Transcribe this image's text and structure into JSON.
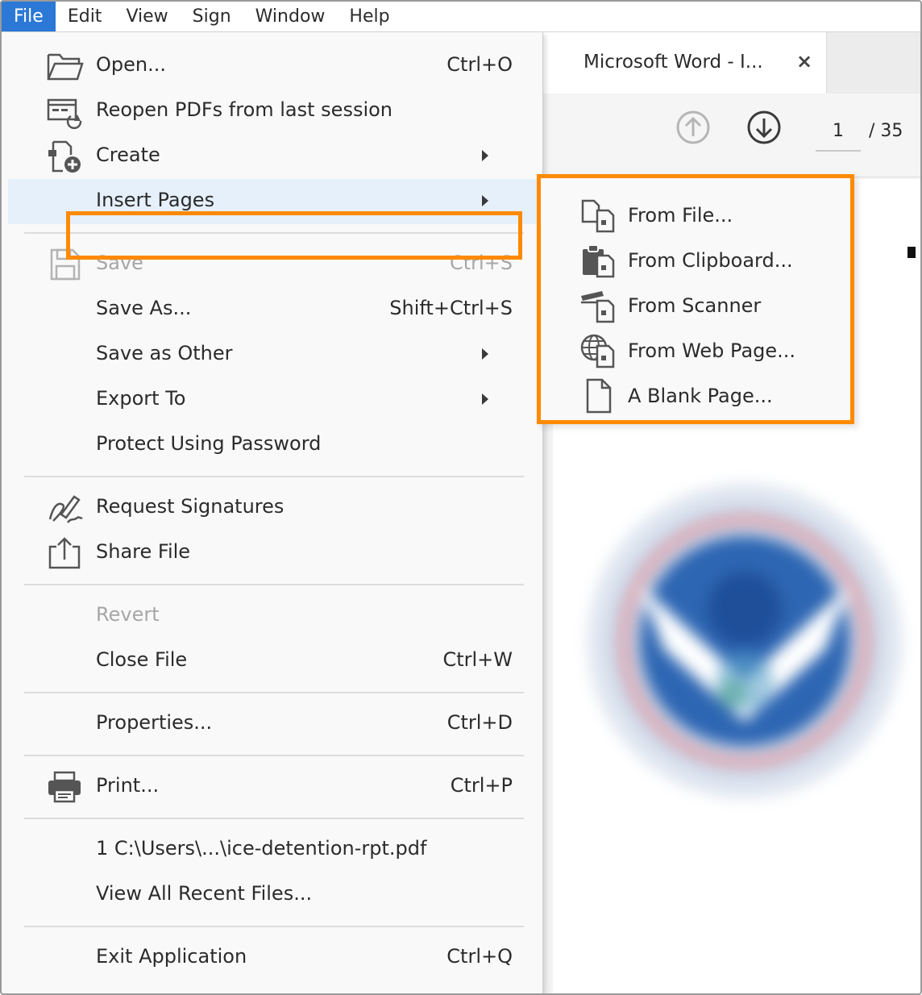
{
  "menubar": {
    "items": [
      {
        "label": "File",
        "active": true
      },
      {
        "label": "Edit"
      },
      {
        "label": "View"
      },
      {
        "label": "Sign"
      },
      {
        "label": "Window"
      },
      {
        "label": "Help"
      }
    ]
  },
  "document": {
    "tab_title": "Microsoft Word - I...",
    "tab_close": "×",
    "page_current": "1",
    "page_total": "/ 35"
  },
  "file_menu": {
    "open": {
      "label": "Open...",
      "shortcut": "Ctrl+O"
    },
    "reopen": {
      "label": "Reopen PDFs from last session"
    },
    "create": {
      "label": "Create"
    },
    "insert_pages": {
      "label": "Insert Pages"
    },
    "save": {
      "label": "Save",
      "shortcut": "Ctrl+S"
    },
    "save_as": {
      "label": "Save As...",
      "shortcut": "Shift+Ctrl+S"
    },
    "save_as_other": {
      "label": "Save as Other"
    },
    "export_to": {
      "label": "Export To"
    },
    "protect": {
      "label": "Protect Using Password"
    },
    "request_signatures": {
      "label": "Request Signatures"
    },
    "share_file": {
      "label": "Share File"
    },
    "revert": {
      "label": "Revert"
    },
    "close_file": {
      "label": "Close File",
      "shortcut": "Ctrl+W"
    },
    "properties": {
      "label": "Properties...",
      "shortcut": "Ctrl+D"
    },
    "print": {
      "label": "Print...",
      "shortcut": "Ctrl+P"
    },
    "recent_1": {
      "label": "1 C:\\Users\\...\\ice-detention-rpt.pdf"
    },
    "view_all_recent": {
      "label": "View All Recent Files..."
    },
    "exit": {
      "label": "Exit Application",
      "shortcut": "Ctrl+Q"
    }
  },
  "insert_submenu": {
    "items": [
      {
        "label": "From File..."
      },
      {
        "label": "From Clipboard..."
      },
      {
        "label": "From Scanner"
      },
      {
        "label": "From Web Page..."
      },
      {
        "label": "A Blank Page..."
      }
    ]
  },
  "colors": {
    "highlight_box": "#ff8a00",
    "menubar_active": "#2b78d6",
    "menu_hover": "#e5f0fb",
    "menu_bg": "#f9f9f9",
    "disabled_text": "#a6a6a6"
  }
}
